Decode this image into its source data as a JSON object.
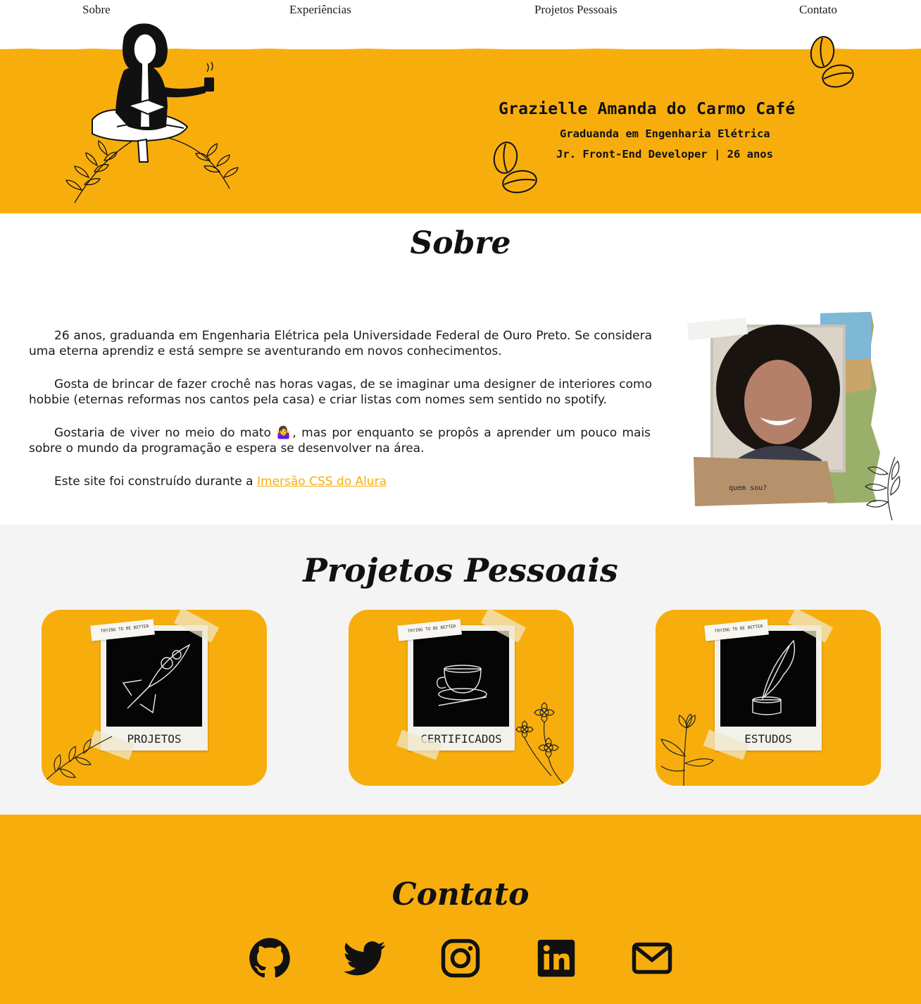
{
  "nav": {
    "items": [
      {
        "label": "Sobre"
      },
      {
        "label": "Experiências"
      },
      {
        "label": "Projetos Pessoais"
      },
      {
        "label": "Contato"
      }
    ]
  },
  "hero": {
    "name": "Grazielle Amanda do Carmo Café",
    "line1": "Graduanda em Engenharia Elétrica",
    "line2": "Jr. Front-End Developer | 26 anos"
  },
  "about": {
    "title": "Sobre",
    "paragraphs": [
      "26 anos, graduanda em Engenharia Elétrica pela Universidade Federal de Ouro Preto. Se considera uma eterna aprendiz e está sempre se aventurando em novos conhecimentos.",
      "Gosta de brincar de fazer crochê nas horas vagas, de se imaginar uma designer de interiores como hobbie (eternas reformas nos cantos pela casa) e criar listas com nomes sem sentido no spotify.",
      "Gostaria de viver no meio do mato 🤷‍♀️, mas por enquanto se propôs a aprender um pouco mais sobre o mundo da programação e espera se desenvolver na área."
    ],
    "credit_prefix": "Este site foi construído durante a ",
    "credit_link": "Imersão CSS do Alura",
    "photo_caption": "quem sou?"
  },
  "projects": {
    "title": "Projetos Pessoais",
    "cards": [
      {
        "label": "PROJETOS",
        "icon": "rocket-icon",
        "tag": "TRYING TO BE BETTER"
      },
      {
        "label": "CERTIFICADOS",
        "icon": "coffee-cup-icon",
        "tag": "TRYING TO BE BETTER"
      },
      {
        "label": "ESTUDOS",
        "icon": "quill-ink-icon",
        "tag": "TRYING TO BE BETTER"
      }
    ]
  },
  "contact": {
    "title": "Contato",
    "links": [
      "github-icon",
      "twitter-icon",
      "instagram-icon",
      "linkedin-icon",
      "email-icon"
    ]
  },
  "colors": {
    "accent": "#f7ae0d",
    "light_bg": "#f4f4f4",
    "text": "#111111"
  }
}
